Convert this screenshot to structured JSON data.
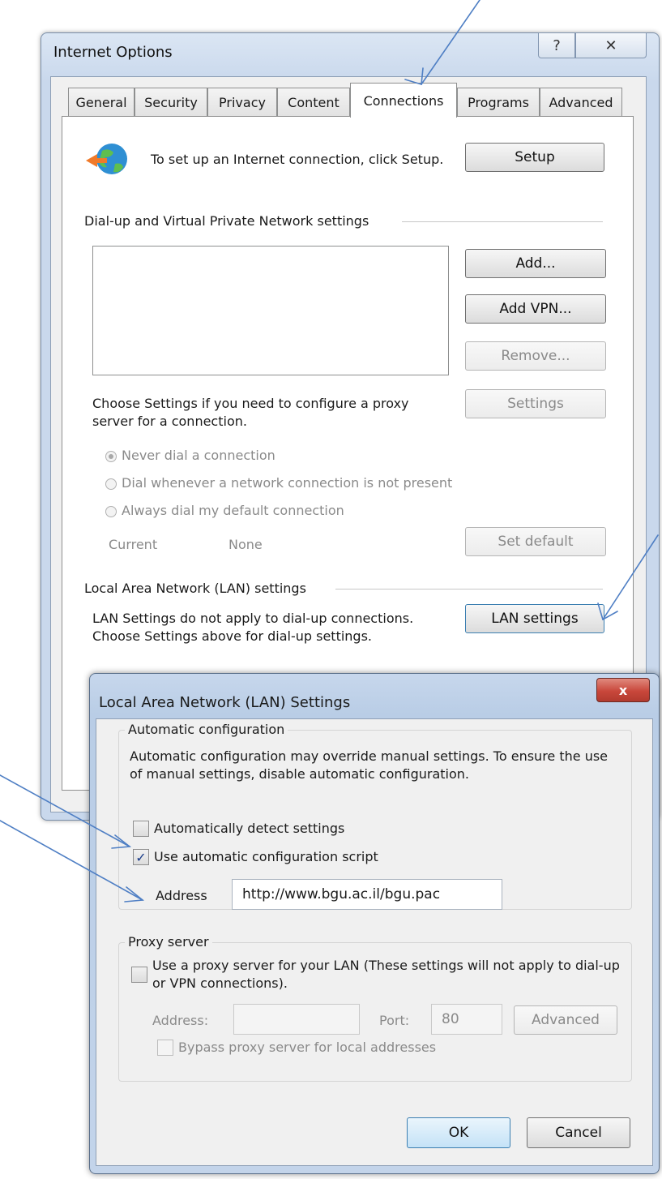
{
  "internet_options": {
    "title": "Internet Options",
    "help_button": "?",
    "close_button": "✕",
    "tabs": [
      "General",
      "Security",
      "Privacy",
      "Content",
      "Connections",
      "Programs",
      "Advanced"
    ],
    "setup_text": "To set up an Internet connection, click Setup.",
    "setup_button": "Setup",
    "dialup_group": "Dial-up and Virtual Private Network settings",
    "add_button": "Add...",
    "add_vpn_button": "Add VPN...",
    "remove_button": "Remove...",
    "proxy_text": "Choose Settings if you need to configure a proxy server for a connection.",
    "settings_button": "Settings",
    "radio_never": "Never dial a connection",
    "radio_whenever": "Dial whenever a network connection is not present",
    "radio_always": "Always dial my default connection",
    "current_label": "Current",
    "current_value": "None",
    "set_default_button": "Set default",
    "lan_group": "Local Area Network (LAN) settings",
    "lan_text": "LAN Settings do not apply to dial-up connections. Choose Settings above for dial-up settings.",
    "lan_settings_button": "LAN settings"
  },
  "lan_dialog": {
    "title": "Local Area Network (LAN) Settings",
    "close_button": "x",
    "auto_group": "Automatic configuration",
    "auto_text": "Automatic configuration may override manual settings.  To ensure the use of manual settings, disable automatic configuration.",
    "auto_detect_label": "Automatically detect settings",
    "auto_detect_checked": false,
    "use_script_label": "Use automatic configuration script",
    "use_script_checked": true,
    "address_label": "Address",
    "address_value": "http://www.bgu.ac.il/bgu.pac",
    "proxy_group": "Proxy server",
    "use_proxy_label": "Use a proxy server for your LAN (These settings will not apply to dial-up or VPN connections).",
    "use_proxy_checked": false,
    "proxy_address_label": "Address:",
    "proxy_address_value": "",
    "port_label": "Port:",
    "port_value": "80",
    "advanced_button": "Advanced",
    "bypass_label": "Bypass proxy server for local addresses",
    "bypass_checked": false,
    "ok_button": "OK",
    "cancel_button": "Cancel"
  },
  "colors": {
    "annotation_arrow": "#4f7fc4",
    "window_frame": "#c9d8ec",
    "close_button_red": "#c9473b"
  }
}
